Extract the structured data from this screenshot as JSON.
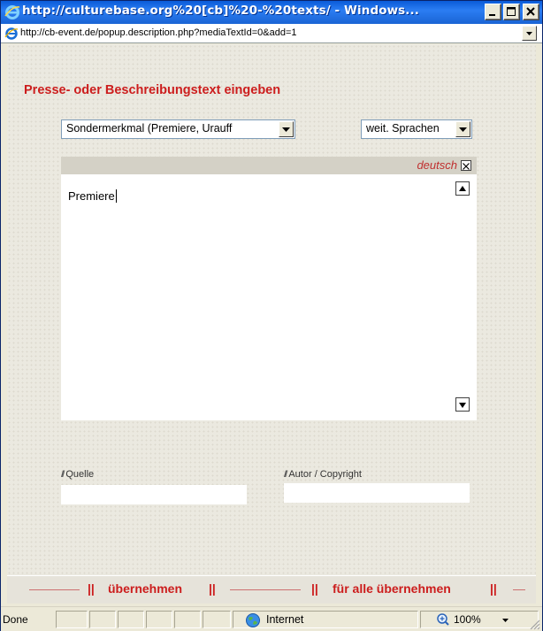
{
  "window": {
    "title": "http://culturebase.org%20[cb]%20-%20texts/ - Windows...",
    "address": "http://cb-event.de/popup.description.php?mediaTextId=0&add=1"
  },
  "page": {
    "heading": "Presse- oder Beschreibungstext eingeben",
    "type_select": {
      "value": "Sondermerkmal (Premiere, Urauff"
    },
    "language_select": {
      "value": "weit. Sprachen"
    },
    "editor": {
      "language": "deutsch",
      "text": "Premiere"
    },
    "fields": {
      "source_label": "Quelle",
      "source_value": "",
      "author_label": "Autor / Copyright",
      "author_value": ""
    },
    "actions": {
      "apply_label": "übernehmen",
      "apply_all_label": "für alle übernehmen",
      "separator": "||"
    }
  },
  "statusbar": {
    "status": "Done",
    "zone": "Internet",
    "zoom": "100%"
  },
  "colors": {
    "accent": "#cc1d1d",
    "titlebar": "#2b7df3"
  }
}
